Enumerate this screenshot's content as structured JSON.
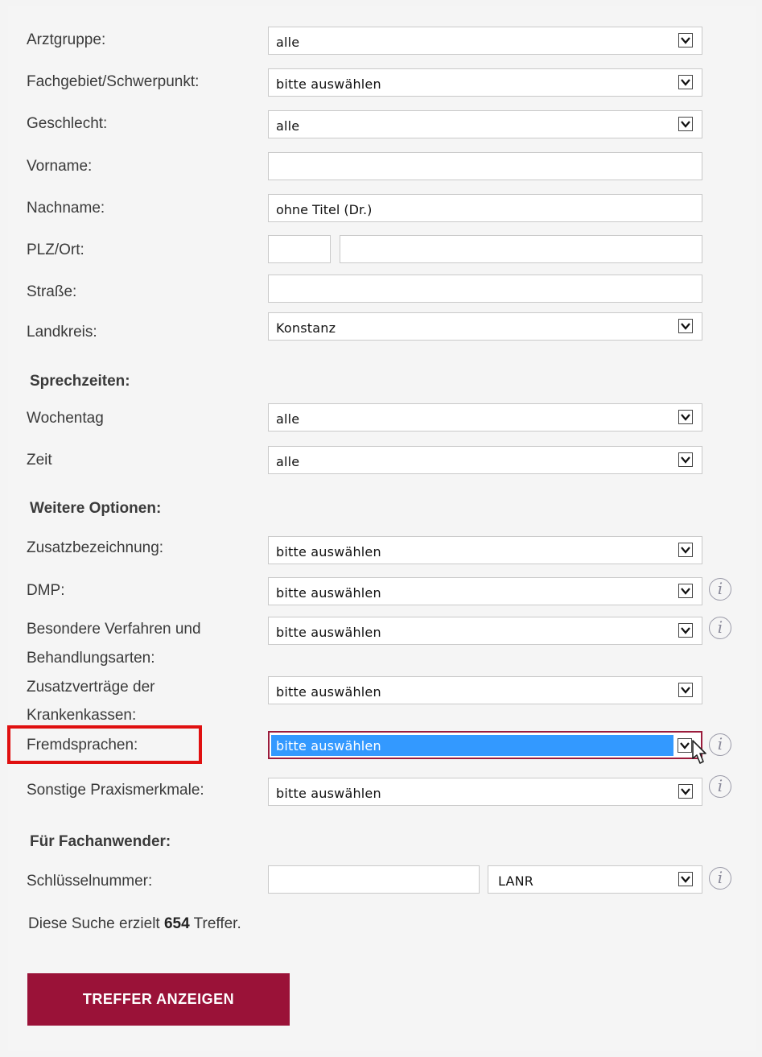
{
  "form": {
    "arztgruppe": {
      "label": "Arztgruppe:",
      "value": "alle"
    },
    "fachgebiet": {
      "label": "Fachgebiet/Schwerpunkt:",
      "value": "bitte auswählen"
    },
    "geschlecht": {
      "label": "Geschlecht:",
      "value": "alle"
    },
    "vorname": {
      "label": "Vorname:",
      "value": ""
    },
    "nachname": {
      "label": "Nachname:",
      "placeholder": "ohne Titel (Dr.)"
    },
    "plz_ort": {
      "label": "PLZ/Ort:",
      "plz": "",
      "ort": ""
    },
    "strasse": {
      "label": "Straße:",
      "value": ""
    },
    "landkreis": {
      "label": "Landkreis:",
      "value": "Konstanz"
    }
  },
  "sprechzeiten": {
    "heading": "Sprechzeiten:",
    "wochentag": {
      "label": "Wochentag",
      "value": "alle"
    },
    "zeit": {
      "label": "Zeit",
      "value": "alle"
    }
  },
  "weitere": {
    "heading": "Weitere Optionen:",
    "zusatzbezeichnung": {
      "label": "Zusatzbezeichnung:",
      "value": "bitte auswählen"
    },
    "dmp": {
      "label": "DMP:",
      "value": "bitte auswählen"
    },
    "verfahren": {
      "label_1": "Besondere Verfahren und",
      "label_2": "Behandlungsarten:",
      "value": "bitte auswählen"
    },
    "zusatzvertraege": {
      "label_1": "Zusatzverträge der",
      "label_2": "Krankenkassen:",
      "value": "bitte auswählen"
    },
    "fremdsprachen": {
      "label": "Fremdsprachen:",
      "value": "bitte auswählen"
    },
    "sonstige": {
      "label": "Sonstige Praxismerkmale:",
      "value": "bitte auswählen"
    }
  },
  "fachanwender": {
    "heading": "Für Fachanwender:",
    "schluessel": {
      "label": "Schlüsselnummer:",
      "value": "",
      "type": "LANR"
    }
  },
  "result": {
    "prefix": "Diese Suche erzielt ",
    "count": "654",
    "suffix": " Treffer."
  },
  "button": {
    "label": "TREFFER ANZEIGEN"
  },
  "icons": {
    "info": "info-icon",
    "arrow": "chevron-down-icon",
    "cursor": "mouse-pointer-icon"
  },
  "colors": {
    "button": "#9a1238",
    "highlight": "#3399ff",
    "focus_border": "#9b1c3c",
    "annotation": "#e01010"
  }
}
